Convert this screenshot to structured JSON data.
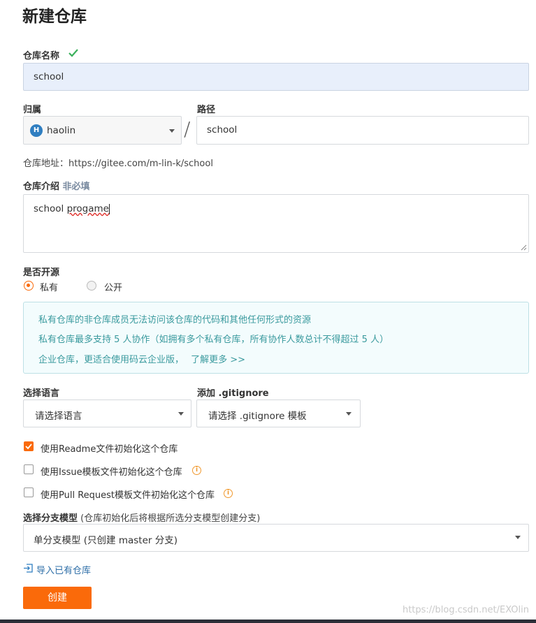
{
  "page": {
    "title": "新建仓库",
    "watermark": "https://blog.csdn.net/EXOlin"
  },
  "repo_name": {
    "label": "仓库名称",
    "value": "school"
  },
  "owner": {
    "label": "归属",
    "avatar_letter": "H",
    "value": "haolin",
    "separator": "/"
  },
  "path": {
    "label": "路径",
    "value": "school"
  },
  "repo_address": "仓库地址：https://gitee.com/m-lin-k/school",
  "description": {
    "label": "仓库介绍",
    "optional_tag": "非必填",
    "value_prefix": "school ",
    "value_misspelled": "progame"
  },
  "visibility": {
    "label": "是否开源",
    "private_label": "私有",
    "public_label": "公开",
    "selected": "private"
  },
  "notice": {
    "line1": "私有仓库的非仓库成员无法访问该仓库的代码和其他任何形式的资源",
    "line2": "私有仓库最多支持 5 人协作（如拥有多个私有仓库，所有协作人数总计不得超过 5 人）",
    "line3_text": "企业仓库，更适合使用码云企业版，",
    "line3_link": "了解更多 >>"
  },
  "language": {
    "label": "选择语言",
    "value": "请选择语言"
  },
  "gitignore": {
    "label": "添加 .gitignore",
    "value": "请选择 .gitignore 模板"
  },
  "checkboxes": [
    {
      "label": "使用Readme文件初始化这个仓库",
      "checked": true
    },
    {
      "label": "使用Issue模板文件初始化这个仓库",
      "checked": false
    },
    {
      "label": "使用Pull Request模板文件初始化这个仓库",
      "checked": false
    }
  ],
  "branch_model": {
    "label": "选择分支模型",
    "hint": "(仓库初始化后将根据所选分支模型创建分支)",
    "value": "单分支模型 (只创建 master 分支)"
  },
  "import_link": "导入已有仓库",
  "create_button": "创建",
  "colors": {
    "accent": "#fa6a0a",
    "check_green": "#3bb15c",
    "notice_text": "#3a9a9e",
    "selected_input_bg": "#e8effb"
  }
}
